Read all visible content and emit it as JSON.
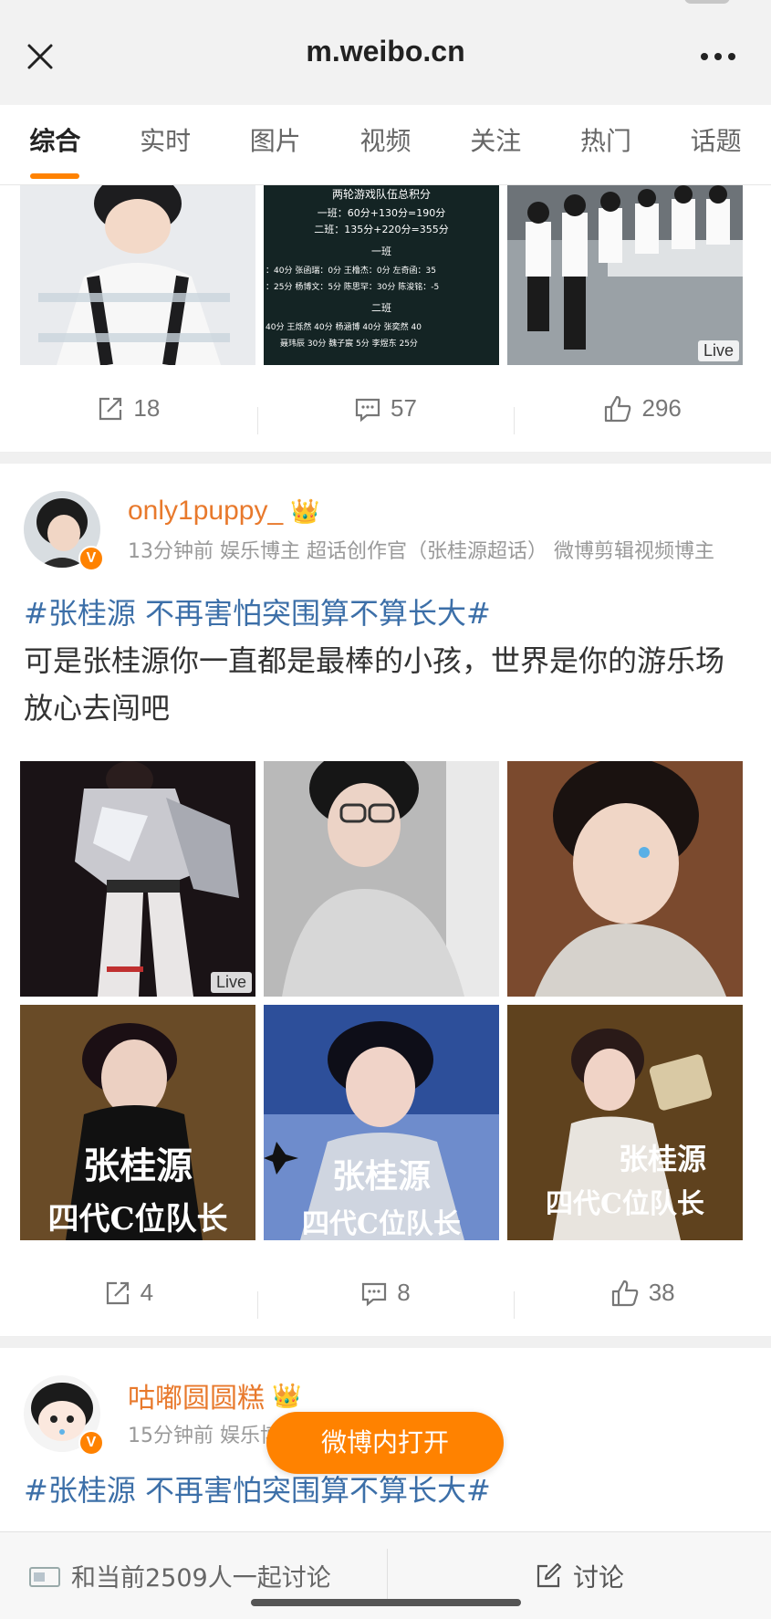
{
  "browser": {
    "url": "m.weibo.cn",
    "close_icon": "close-icon",
    "more_icon": "more-icon"
  },
  "tabs": [
    {
      "label": "综合",
      "active": true
    },
    {
      "label": "实时",
      "active": false
    },
    {
      "label": "图片",
      "active": false
    },
    {
      "label": "视频",
      "active": false
    },
    {
      "label": "关注",
      "active": false
    },
    {
      "label": "热门",
      "active": false
    },
    {
      "label": "话题",
      "active": false
    }
  ],
  "prev_post": {
    "image2_text": {
      "title": "两轮游戏队伍总积分",
      "line1": "一班：60分+130分=190分",
      "line2": "二班：135分+220分=355分",
      "section1": "一班",
      "row1": "：40分 张函瑞：0分 王橹杰：0分 左奇函：35",
      "row2": "：25分 杨博文：5分 陈思罕：30分 陈浚铭：-5",
      "section2": "二班",
      "row3": "40分 王烁然 40分 杨涵博 40分 张奕然 40",
      "row4": "聂玮辰 30分 魏子宸 5分 李煜东 25分"
    },
    "image3_live": "Live",
    "repost": "18",
    "comment": "57",
    "like": "296"
  },
  "post1": {
    "username": "only1puppy_",
    "meta": "13分钟前 娱乐博主 超话创作官（张桂源超话） 微博剪辑视频博主",
    "hashtag": "#张桂源 不再害怕突围算不算长大#",
    "text": "可是张桂源你一直都是最棒的小孩，世界是你的游乐场放心去闯吧",
    "image1_live": "Live",
    "poster_texts": [
      "张桂源",
      "四代C位队长"
    ],
    "repost": "4",
    "comment": "8",
    "like": "38"
  },
  "post2": {
    "username": "咕嘟圆圆糕",
    "meta": "15分钟前 娱乐博主",
    "hashtag": "#张桂源 不再害怕突围算不算长大#"
  },
  "open_button": "微博内打开",
  "bottom": {
    "discuss_prompt": "和当前2509人一起讨论",
    "discuss_button": "讨论"
  },
  "colors": {
    "accent": "#ff8200",
    "username": "#e8792c",
    "hashtag": "#3c6fa8"
  }
}
